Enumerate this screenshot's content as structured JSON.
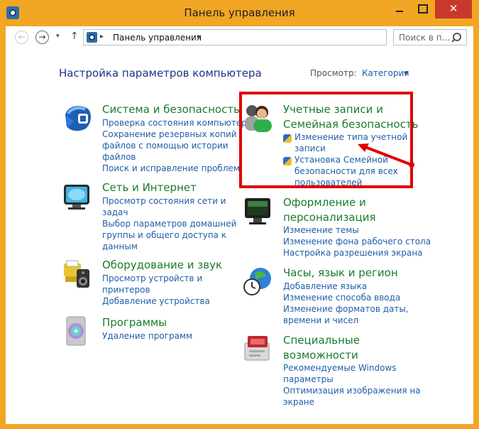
{
  "window": {
    "title": "Панель управления",
    "close_glyph": "✕"
  },
  "nav": {
    "back_icon": "←",
    "forward_icon": "→",
    "history_icon": "▾",
    "up_icon": "↑",
    "address_text": "Панель управления",
    "address_sep": "▸",
    "refresh_icon": "↻",
    "search_placeholder": "Поиск в п..."
  },
  "header": {
    "title": "Настройка параметров компьютера",
    "view_label": "Просмотр:",
    "view_value": "Категория"
  },
  "categories": {
    "system": {
      "title": "Система и безопасность",
      "links": [
        "Проверка состояния компьютера",
        "Сохранение резервных копий",
        "файлов с помощью истории",
        "файлов",
        "Поиск и исправление проблем"
      ]
    },
    "network": {
      "title": "Сеть и Интернет",
      "links": [
        "Просмотр состояния сети и",
        "задач",
        "Выбор параметров домашней",
        "группы и общего доступа к",
        "данным"
      ]
    },
    "hardware": {
      "title": "Оборудование и звук",
      "links": [
        "Просмотр устройств и",
        "принтеров",
        "Добавление устройства"
      ]
    },
    "programs": {
      "title": "Программы",
      "links": [
        "Удаление программ"
      ]
    },
    "accounts": {
      "title_line1": "Учетные записи и",
      "title_line2": "Семейная безопасность",
      "links": [
        "Изменение типа учетной",
        "записи",
        "Установка Семейной",
        "безопасности для всех",
        "пользователей"
      ]
    },
    "appearance": {
      "title_line1": "Оформление и",
      "title_line2": "персонализация",
      "links": [
        "Изменение темы",
        "Изменение фона рабочего стола",
        "Настройка разрешения экрана"
      ]
    },
    "clock": {
      "title": "Часы, язык и регион",
      "links": [
        "Добавление языка",
        "Изменение способа ввода",
        "Изменение форматов даты,",
        "времени и чисел"
      ]
    },
    "access": {
      "title_line1": "Специальные",
      "title_line2": "возможности",
      "links": [
        "Рекомендуемые Windows",
        "параметры",
        "Оптимизация изображения на",
        "экране"
      ]
    }
  },
  "colors": {
    "frame": "#f1a624",
    "link": "#1f5ea8",
    "category_title": "#187c2b",
    "heading": "#1e3287",
    "highlight": "#e00000"
  }
}
